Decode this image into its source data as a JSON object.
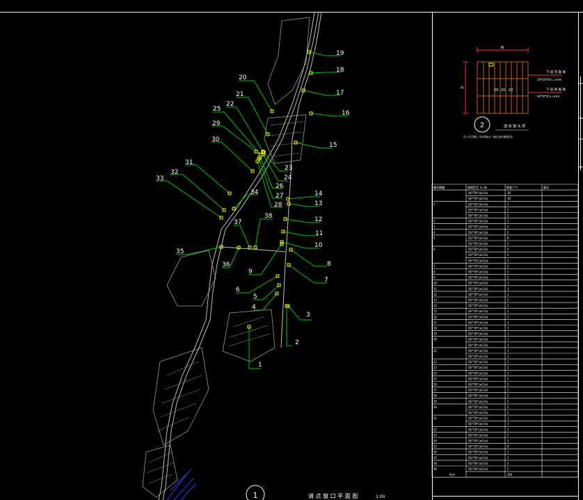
{
  "app": {
    "colors": {
      "background": "#000000",
      "frame": "#ffffff",
      "leader": "#00c800",
      "marker": "#ffff00",
      "road": "#bfbfbf",
      "hatch": "#9a9a9a",
      "detail_wood": "#c86414",
      "detail_dim": "#ff3030",
      "water": "#2a3cff",
      "table_line": "#ffffff"
    }
  },
  "plan": {
    "title": "请 点 窗 口 平 面 图",
    "scale": "1:00",
    "circle_number": "1",
    "callouts": [
      {
        "label": "1"
      },
      {
        "label": "2"
      },
      {
        "label": "3"
      },
      {
        "label": "4"
      },
      {
        "label": "5"
      },
      {
        "label": "6"
      },
      {
        "label": "7"
      },
      {
        "label": "8"
      },
      {
        "label": "9"
      },
      {
        "label": "10"
      },
      {
        "label": "11"
      },
      {
        "label": "12"
      },
      {
        "label": "13"
      },
      {
        "label": "14"
      },
      {
        "label": "15"
      },
      {
        "label": "16"
      },
      {
        "label": "17"
      },
      {
        "label": "18"
      },
      {
        "label": "19"
      },
      {
        "label": "20"
      },
      {
        "label": "21"
      },
      {
        "label": "22"
      },
      {
        "label": "23"
      },
      {
        "label": "24"
      },
      {
        "label": "25"
      },
      {
        "label": "26"
      },
      {
        "label": "27"
      },
      {
        "label": "28"
      },
      {
        "label": "29"
      },
      {
        "label": "30"
      },
      {
        "label": "31"
      },
      {
        "label": "32"
      },
      {
        "label": "33"
      },
      {
        "label": "34"
      },
      {
        "label": "35"
      },
      {
        "label": "36"
      },
      {
        "label": "37"
      },
      {
        "label": "38"
      }
    ]
  },
  "detail": {
    "circle_number": "2",
    "title": "透 出 窗 大 样",
    "dim_top": "W",
    "dim_left": "H",
    "note_1": "下 层 内 筋 板",
    "note_1b": "20*20*8 L=mm",
    "note_2": "下 层 纵 筋 板",
    "note_2b": "60*8*8 L=mm",
    "inner_labels": [
      "20",
      "20",
      "20"
    ],
    "caption_small": "注:1.尺寸单位 - 均以毫米计，标高以米计数单位计"
  },
  "table": {
    "headers": [
      "编号图编",
      "规格型号 & mm",
      "数量(个)",
      "备注"
    ],
    "rows": [
      {
        "no": "",
        "spec": "50*70*Lm(Cm)",
        "qty": "10"
      },
      {
        "no": "",
        "spec": "50*70*Lm(Cm)",
        "qty": "10"
      },
      {
        "no": "1",
        "spec": "50*70*Lm(Cm)",
        "qty": "2"
      },
      {
        "no": "",
        "spec": "50*70*Lm(Cm)",
        "qty": "2"
      },
      {
        "no": "",
        "spec": "50*70*Lm(Cm)",
        "qty": "2"
      },
      {
        "no": "2",
        "spec": "50*70*Lm(Cm)",
        "qty": "2"
      },
      {
        "no": "3",
        "spec": "50*70*Lm(Cm)",
        "qty": "2"
      },
      {
        "no": "4",
        "spec": "50*70*Lm(Cm)",
        "qty": "2"
      },
      {
        "no": "5",
        "spec": "50*70*Lm(Cm)",
        "qty": "8"
      },
      {
        "no": "",
        "spec": "50*70*Lm(Cm)",
        "qty": "2"
      },
      {
        "no": "6",
        "spec": "50*70*Lm(Cm)",
        "qty": "2"
      },
      {
        "no": "",
        "spec": "50*70*Lm(Cm)",
        "qty": "2"
      },
      {
        "no": "",
        "spec": "50*70*Lm(Cm)",
        "qty": "2"
      },
      {
        "no": "7",
        "spec": "50*70*Lm(Cm)",
        "qty": "2"
      },
      {
        "no": "8",
        "spec": "50*70*Lm(Cm)",
        "qty": "2"
      },
      {
        "no": "9",
        "spec": "50*70*Lm(Cm)",
        "qty": "2"
      },
      {
        "no": "10",
        "spec": "50*70*Lm(Cm)",
        "qty": "1"
      },
      {
        "no": "11",
        "spec": "50*70*Lm(Cm)",
        "qty": "1"
      },
      {
        "no": "12",
        "spec": "50*70*Lm(Cm)",
        "qty": "2"
      },
      {
        "no": "13",
        "spec": "50*70*Lm(Cm)",
        "qty": "2"
      },
      {
        "no": "14",
        "spec": "50*70*Lm(Cm)",
        "qty": "2"
      },
      {
        "no": "15",
        "spec": "50*70*Lm(Cm)",
        "qty": "2"
      },
      {
        "no": "16",
        "spec": "50*70*Lm(Cm)",
        "qty": "2"
      },
      {
        "no": "17",
        "spec": "50*70*Lm(Cm)",
        "qty": "1"
      },
      {
        "no": "18",
        "spec": "50*70*Lm(Cm)",
        "qty": "2"
      },
      {
        "no": "19",
        "spec": "50*70*Lm(Cm)",
        "qty": "1"
      },
      {
        "no": "20",
        "spec": "50*70*Lm(Cm)",
        "qty": "1"
      },
      {
        "no": "",
        "spec": "50*70*Lm(Cm)",
        "qty": "1"
      },
      {
        "no": "21",
        "spec": "50*70*Lm(Cm)",
        "qty": "1"
      },
      {
        "no": "",
        "spec": "50*70*Lm(Cm)",
        "qty": "1"
      },
      {
        "no": "22",
        "spec": "50*70*Lm(Cm)",
        "qty": "2"
      },
      {
        "no": "23",
        "spec": "50*70*Lm(Cm)",
        "qty": "2"
      },
      {
        "no": "24",
        "spec": "50*70*Lm(Cm)",
        "qty": "2"
      },
      {
        "no": "25",
        "spec": "50*70*Lm(Cm)",
        "qty": "2"
      },
      {
        "no": "26",
        "spec": "50*70*Lm(Cm)",
        "qty": "2"
      },
      {
        "no": "27",
        "spec": "50*70*Lm(Cm)",
        "qty": "2"
      },
      {
        "no": "28",
        "spec": "50*70*Lm(Cm)",
        "qty": "2"
      },
      {
        "no": "29",
        "spec": "50*70*Lm(Cm)",
        "qty": "2"
      },
      {
        "no": "30",
        "spec": "50*70*Lm(Cm)",
        "qty": "2"
      },
      {
        "no": "",
        "spec": "50*70*Lm(Cm)",
        "qty": "2"
      },
      {
        "no": "31",
        "spec": "50*70*Lm(Cm)",
        "qty": "1"
      },
      {
        "no": "",
        "spec": "50*70*Lm(Cm)",
        "qty": "1"
      },
      {
        "no": "32",
        "spec": "50*70*Lm(Cm)",
        "qty": "2"
      },
      {
        "no": "33",
        "spec": "50*70*Lm(Cm)",
        "qty": "2"
      },
      {
        "no": "34",
        "spec": "50*70*Lm(Cm)",
        "qty": "1"
      },
      {
        "no": "35",
        "spec": "50*70*Lm(Cm)",
        "qty": "8"
      },
      {
        "no": "36",
        "spec": "50*70*Lm(Cm)",
        "qty": "2"
      },
      {
        "no": "37",
        "spec": "50*70*Lm(Cm)",
        "qty": "2"
      },
      {
        "no": "38",
        "spec": "50*70*Lm(Cm)",
        "qty": "2"
      },
      {
        "no": "38",
        "spec": "50*70*Lm(Cm)",
        "qty": "2"
      }
    ],
    "total_label": "合计",
    "total_value": "104"
  }
}
